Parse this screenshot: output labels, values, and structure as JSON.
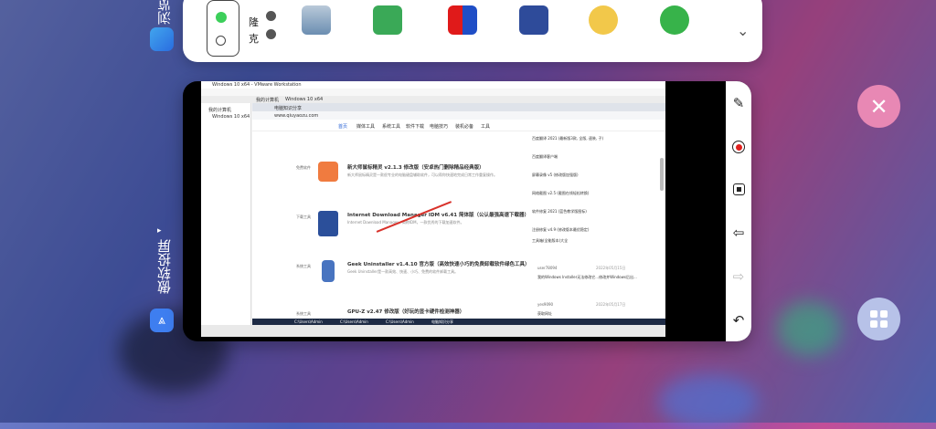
{
  "rail": {
    "app_browser_label": "浏览器",
    "app_cast_label": "傲软投屏",
    "chevron": "▸"
  },
  "top_card": {
    "keyboard_chars": [
      "克",
      "隆"
    ],
    "apps": [
      "drive-icon",
      "board-icon",
      "media-icon",
      "book-icon",
      "mascot-icon",
      "green-app-icon"
    ],
    "more_chevron": "⌄"
  },
  "vm": {
    "title": "Windows 10 x64 - VMware Workstation",
    "tab_home": "我的计算机",
    "tab_vm": "Windows 10 x64",
    "tree_root": "我的计算机",
    "tree_item": "Windows 10 x64",
    "browser_tab": "电脑知识分享",
    "url": "www.qiuyaozu.com",
    "nav": [
      "首页",
      "媒体工具",
      "系统工具",
      "软件下载",
      "电脑技巧",
      "装机必备",
      "工具"
    ],
    "articles": [
      {
        "title": "新大师鼠标精灵 v2.1.3 修改版（安卓热门删除精品经典版）",
        "desc": "新大师鼠标精灵是一款很专业的电脑键盘辅助软件，可以帮你快速地完成日常工作重复操作。",
        "tag": "免费软件"
      },
      {
        "title": "Internet Download Manager IDM v6.41 简体版（公认最强高速下载器）",
        "desc": "Internet Download Manager，简称IDM，一款优秀的下载加速软件。",
        "tag": "下载工具"
      },
      {
        "title": "Geek Uninstaller v1.4.10 官方版（高效快速小巧的免费卸载软件绿色工具）",
        "desc": "Geek Uninstaller是一款高效、快速、小巧、免费的软件卸载工具。",
        "tag": "系统工具"
      },
      {
        "title": "GPU-Z v2.47 修改版（好玩的显卡硬件检测神器）",
        "desc": "",
        "tag": "系统工具"
      }
    ],
    "sidebar_links": [
      "百度翻译 2021 (最新版3款, 全版, 速装, 子)",
      "百度翻译客户端",
      "屏幕录像 v5 (修改版加强版)",
      "网络截图 v2.5 (截图在线轻松转换)",
      "软件修复 2021 (蓝色教学版图标)",
      "注册修复 v4.9 (修改版本最优稳定)",
      "工具箱(全能版本)大全"
    ],
    "comments": [
      {
        "user": "user78094",
        "date": "2022年05月15日",
        "text": "我的Windows Installer无法修改它...修改并Windows后出..."
      },
      {
        "user": "yes9090",
        "date": "2022年05月17日",
        "text": "获取网址"
      }
    ],
    "taskbar_items": [
      "C:\\Users\\Admin",
      "C:\\Users\\Admin",
      "C:\\Users\\Admin",
      "电脑知识分享"
    ]
  },
  "toolbar": {
    "pen": "pen-tool",
    "record": "record",
    "stop": "stop",
    "back": "back",
    "forward": "forward",
    "undo": "undo"
  },
  "colors": {
    "close_btn": "#e888b4",
    "grid_btn": "#b7c2e8",
    "record": "#e0201e",
    "cast_icon": "#3e7ef0"
  }
}
